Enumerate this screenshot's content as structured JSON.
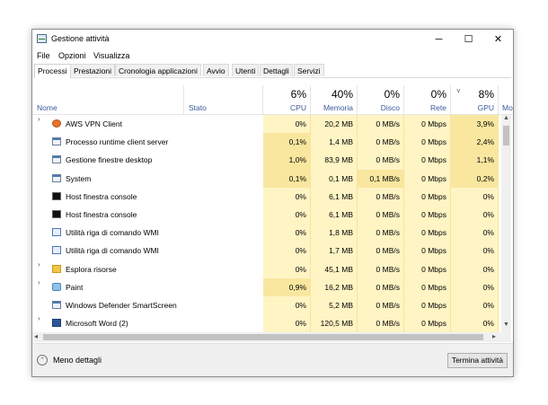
{
  "window": {
    "title": "Gestione attività",
    "controls": [
      "─",
      "☐",
      "✕"
    ]
  },
  "menu": [
    "File",
    "Opzioni",
    "Visualizza"
  ],
  "tabs": [
    "Processi",
    "Prestazioni",
    "Cronologia applicazioni",
    "Avvio",
    "Utenti",
    "Dettagli",
    "Servizi"
  ],
  "header": {
    "name": "Nome",
    "status": "Stato",
    "cpu": {
      "pct": "6%",
      "label": "CPU"
    },
    "memory": {
      "pct": "40%",
      "label": "Memoria"
    },
    "disk": {
      "pct": "0%",
      "label": "Disco"
    },
    "network": {
      "pct": "0%",
      "label": "Rete"
    },
    "gpu": {
      "pct": "8%",
      "label": "GPU",
      "sort": "˅"
    },
    "clipped": "Mo"
  },
  "processes": [
    {
      "name": "AWS VPN Client",
      "expand": "›",
      "icon": "vpn",
      "cpu": "0%",
      "memory": "20,2 MB",
      "disk": "0 MB/s",
      "network": "0 Mbps",
      "gpu": "3,9%"
    },
    {
      "name": "Processo runtime client server",
      "expand": "",
      "icon": "win",
      "cpu": "0,1%",
      "memory": "1,4 MB",
      "disk": "0 MB/s",
      "network": "0 Mbps",
      "gpu": "2,4%"
    },
    {
      "name": "Gestione finestre desktop",
      "expand": "",
      "icon": "win",
      "cpu": "1,0%",
      "memory": "83,9 MB",
      "disk": "0 MB/s",
      "network": "0 Mbps",
      "gpu": "1,1%"
    },
    {
      "name": "System",
      "expand": "",
      "icon": "win",
      "cpu": "0,1%",
      "memory": "0,1 MB",
      "disk": "0,1 MB/s",
      "network": "0 Mbps",
      "gpu": "0,2%"
    },
    {
      "name": "Host finestra console",
      "expand": "",
      "icon": "cmd",
      "cpu": "0%",
      "memory": "6,1 MB",
      "disk": "0 MB/s",
      "network": "0 Mbps",
      "gpu": "0%"
    },
    {
      "name": "Host finestra console",
      "expand": "",
      "icon": "cmd",
      "cpu": "0%",
      "memory": "6,1 MB",
      "disk": "0 MB/s",
      "network": "0 Mbps",
      "gpu": "0%"
    },
    {
      "name": "Utilità riga di comando WMI",
      "expand": "",
      "icon": "wmi",
      "cpu": "0%",
      "memory": "1,8 MB",
      "disk": "0 MB/s",
      "network": "0 Mbps",
      "gpu": "0%"
    },
    {
      "name": "Utilità riga di comando WMI",
      "expand": "",
      "icon": "wmi",
      "cpu": "0%",
      "memory": "1,7 MB",
      "disk": "0 MB/s",
      "network": "0 Mbps",
      "gpu": "0%"
    },
    {
      "name": "Esplora risorse",
      "expand": "›",
      "icon": "folder",
      "cpu": "0%",
      "memory": "45,1 MB",
      "disk": "0 MB/s",
      "network": "0 Mbps",
      "gpu": "0%"
    },
    {
      "name": "Paint",
      "expand": "›",
      "icon": "paint",
      "cpu": "0,9%",
      "memory": "16,2 MB",
      "disk": "0 MB/s",
      "network": "0 Mbps",
      "gpu": "0%"
    },
    {
      "name": "Windows Defender SmartScreen",
      "expand": "",
      "icon": "win",
      "cpu": "0%",
      "memory": "5,2 MB",
      "disk": "0 MB/s",
      "network": "0 Mbps",
      "gpu": "0%"
    },
    {
      "name": "Microsoft Word (2)",
      "expand": "›",
      "icon": "word",
      "cpu": "0%",
      "memory": "120,5 MB",
      "disk": "0 MB/s",
      "network": "0 Mbps",
      "gpu": "0%"
    }
  ],
  "footer": {
    "fewer_details": "Meno dettagli",
    "end_task": "Termina attività"
  },
  "colors": {
    "highlight_light": "#fff4c4",
    "highlight_medium": "#f9e79f",
    "header_text": "#3c5a99"
  }
}
